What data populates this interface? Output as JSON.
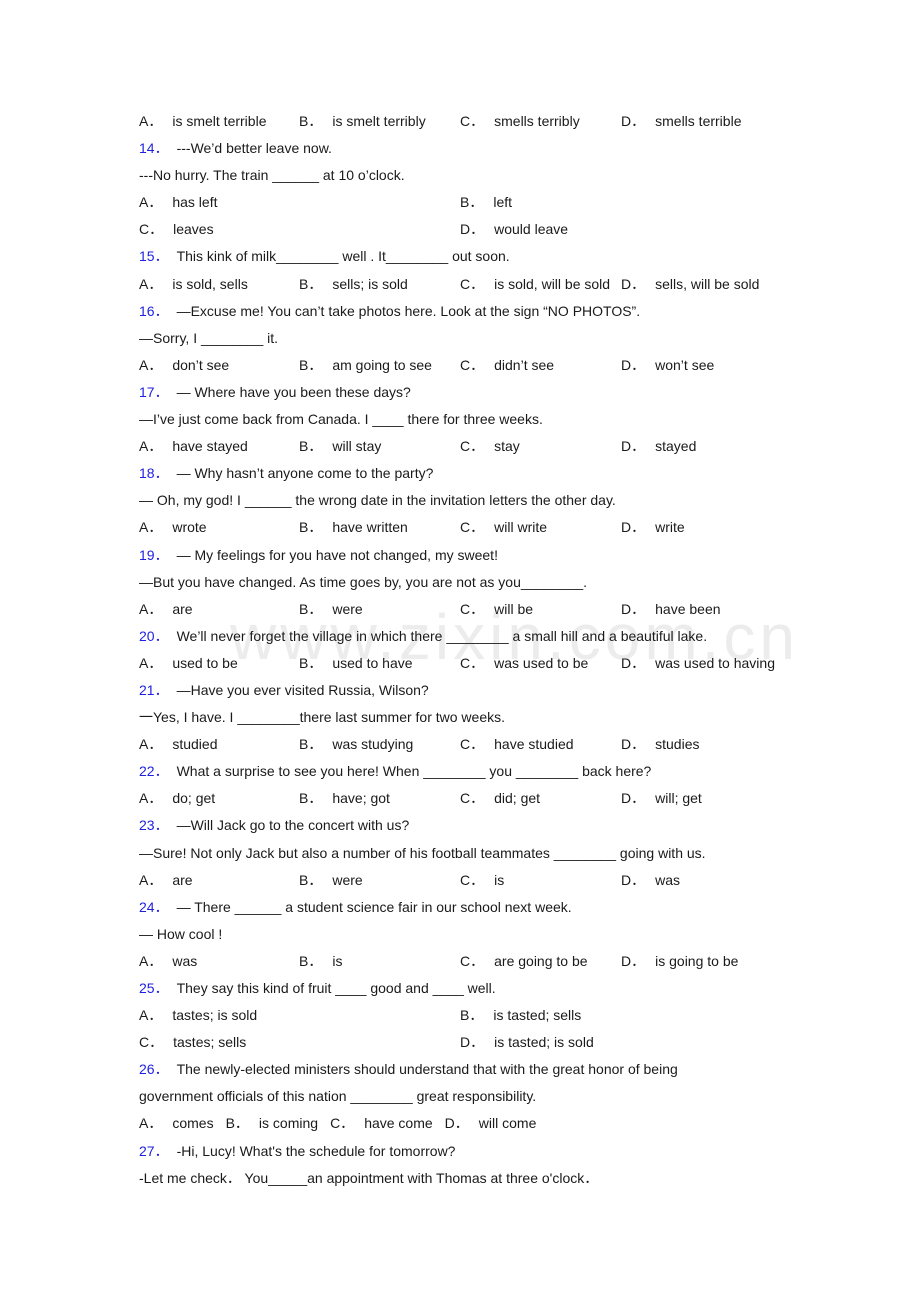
{
  "watermark": "www.zixin.com.cn",
  "colors": {
    "question_number": "#1f1fe0",
    "text": "#1a1a1a"
  },
  "q13_options": [
    "is smelt terrible",
    "is smelt terribly",
    "smells terribly",
    "smells terrible"
  ],
  "option_labels": [
    "A．",
    "B．",
    "C．",
    "D．"
  ],
  "questions": [
    {
      "num": "14．",
      "lines": [
        "---We’d better leave now.",
        "---No hurry. The train ______ at 10 o’clock."
      ],
      "options": [
        "has left",
        "left",
        "leaves",
        "would leave"
      ]
    },
    {
      "num": "15．",
      "lines": [
        "This kink of milk________ well . It________ out soon."
      ],
      "options": [
        "is sold, sells",
        "sells; is sold",
        "is sold, will be sold",
        "sells, will be sold"
      ]
    },
    {
      "num": "16．",
      "lines": [
        "—Excuse me! You can’t take photos here. Look at the sign “NO PHOTOS”.",
        "—Sorry, I ________ it."
      ],
      "options": [
        "don’t see",
        "am going to see",
        "didn’t see",
        "won’t see"
      ]
    },
    {
      "num": "17．",
      "lines": [
        "— Where have you been these days?",
        "—I’ve just come back from Canada. I ____ there for three weeks."
      ],
      "options": [
        "have stayed",
        "will stay",
        "stay",
        "stayed"
      ]
    },
    {
      "num": "18．",
      "lines": [
        "— Why hasn’t anyone come to the party?",
        "— Oh, my god! I ______ the wrong date in the invitation letters the other day."
      ],
      "options": [
        "wrote",
        "have written",
        "will write",
        "write"
      ]
    },
    {
      "num": "19．",
      "lines": [
        "— My feelings for you have not changed, my sweet!",
        "—But you have changed. As time goes by, you are not as you________."
      ],
      "options": [
        "are",
        "were",
        "will be",
        "have been"
      ]
    },
    {
      "num": "20．",
      "lines": [
        "We’ll never forget the village in which there ________ a small hill and a beautiful lake."
      ],
      "options": [
        "used to be",
        "used to have",
        "was used to be",
        "was used to having"
      ]
    },
    {
      "num": "21．",
      "lines": [
        "—Have you ever visited Russia, Wilson?",
        "一Yes, I have. I ________there last summer for two weeks."
      ],
      "options": [
        "studied",
        "was studying",
        "have studied",
        "studies"
      ]
    },
    {
      "num": "22．",
      "lines": [
        "What a surprise to see you here! When ________ you ________ back here?"
      ],
      "options": [
        "do; get",
        "have; got",
        "did; get",
        "will; get"
      ]
    },
    {
      "num": "23．",
      "lines": [
        "—Will Jack go to the concert with us?",
        "—Sure! Not only Jack but also a number of his football teammates ________ going with us."
      ],
      "options": [
        "are",
        "were",
        "is",
        "was"
      ]
    },
    {
      "num": "24．",
      "lines": [
        "— There ______ a student science fair in our school next week.",
        "— How cool !"
      ],
      "options": [
        "was",
        "is",
        "are going to be",
        "is going to be"
      ]
    },
    {
      "num": "25．",
      "lines": [
        "They say this kind of fruit ____ good and ____ well."
      ],
      "options": [
        "tastes; is sold",
        "is tasted; sells",
        "tastes; sells",
        "is tasted; is sold"
      ]
    },
    {
      "num": "26．",
      "lines": [
        "The newly-elected ministers should understand that with the great honor of being",
        "government officials of this nation ________ great responsibility."
      ],
      "options": [
        "comes",
        "is coming",
        "have come",
        "will come"
      ]
    },
    {
      "num": "27．",
      "lines": [
        "-Hi, Lucy! What's the schedule for tomorrow?",
        "-Let me check． You_____an appointment with Thomas at three o'clock．"
      ],
      "options": []
    }
  ]
}
